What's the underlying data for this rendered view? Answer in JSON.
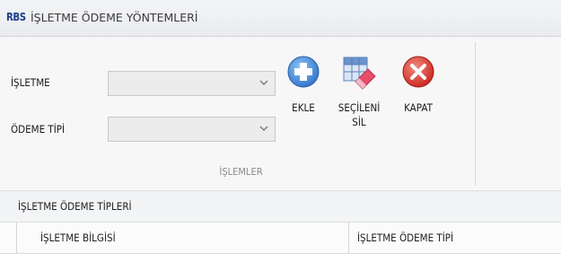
{
  "window": {
    "logo": "RBS",
    "title": "İŞLETME ÖDEME YÖNTEMLERİ"
  },
  "ribbon": {
    "fields": [
      {
        "label": "İŞLETME",
        "value": ""
      },
      {
        "label": "ÖDEME TİPİ",
        "value": ""
      }
    ],
    "buttons": {
      "add": {
        "label": "EKLE",
        "icon": "plus-circle-icon"
      },
      "delete_selected": {
        "label_line1": "SEÇİLENİ",
        "label_line2": "SİL",
        "icon": "eraser-icon"
      },
      "close": {
        "label": "KAPAT",
        "icon": "close-circle-icon"
      }
    },
    "group_caption": "İŞLEMLER"
  },
  "grid": {
    "panel_title": "İŞLETME ÖDEME TİPLERİ",
    "columns": [
      "İŞLETME BİLGİSİ",
      "İŞLETME ÖDEME TİPİ"
    ]
  },
  "colors": {
    "add": "#3b83d6",
    "close": "#d8302a",
    "eraser": "#e84d6a"
  }
}
